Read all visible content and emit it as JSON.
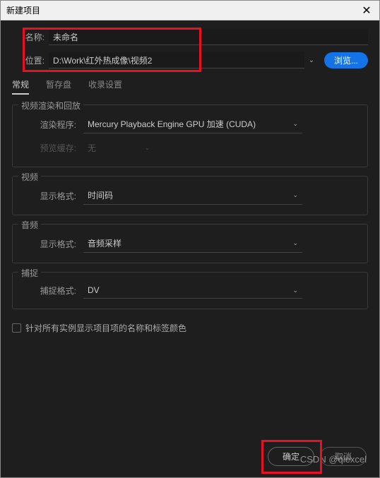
{
  "titlebar": {
    "title": "新建项目",
    "close": "✕"
  },
  "fields": {
    "name_label": "名称:",
    "name_value": "未命名",
    "location_label": "位置:",
    "location_value": "D:\\Work\\红外热成像\\视频2",
    "browse_label": "浏览..."
  },
  "tabs": {
    "general": "常规",
    "scratch": "暂存盘",
    "ingest": "收录设置"
  },
  "sections": {
    "video_render": {
      "title": "视频渲染和回放",
      "renderer_label": "渲染程序:",
      "renderer_value": "Mercury Playback Engine GPU 加速 (CUDA)",
      "preview_label": "预览缓存:",
      "preview_value": "无"
    },
    "video": {
      "title": "视频",
      "format_label": "显示格式:",
      "format_value": "时间码"
    },
    "audio": {
      "title": "音频",
      "format_label": "显示格式:",
      "format_value": "音频采样"
    },
    "capture": {
      "title": "捕捉",
      "format_label": "捕捉格式:",
      "format_value": "DV"
    }
  },
  "checkbox": {
    "label": "针对所有实例显示项目项的名称和标签颜色"
  },
  "footer": {
    "ok": "确定",
    "cancel": "取消"
  },
  "watermark": "CSDN @qlexcel"
}
